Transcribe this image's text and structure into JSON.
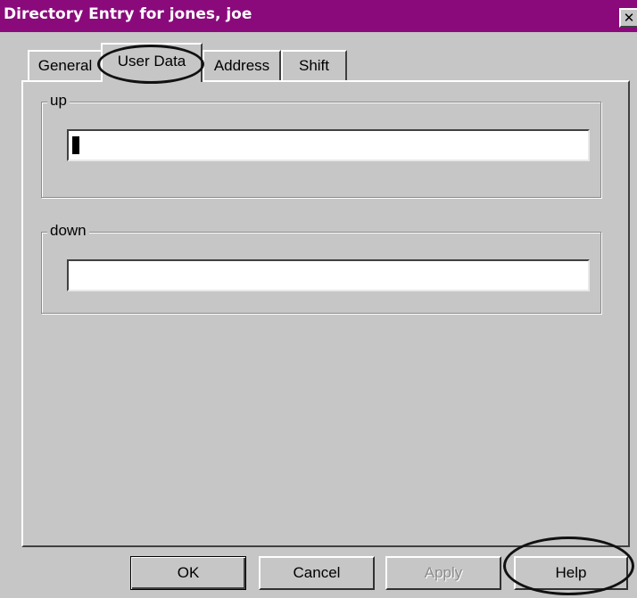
{
  "window": {
    "title": "Directory Entry for jones, joe",
    "close_glyph": "✕",
    "titlebar_color": "#8a0a7c"
  },
  "tabs": [
    {
      "label": "General",
      "selected": false
    },
    {
      "label": "User Data",
      "selected": true
    },
    {
      "label": "Address",
      "selected": false
    },
    {
      "label": "Shift",
      "selected": false
    }
  ],
  "groups": {
    "up": {
      "label": "up",
      "value": ""
    },
    "down": {
      "label": "down",
      "value": ""
    }
  },
  "buttons": {
    "ok": "OK",
    "cancel": "Cancel",
    "apply": "Apply",
    "help": "Help"
  }
}
